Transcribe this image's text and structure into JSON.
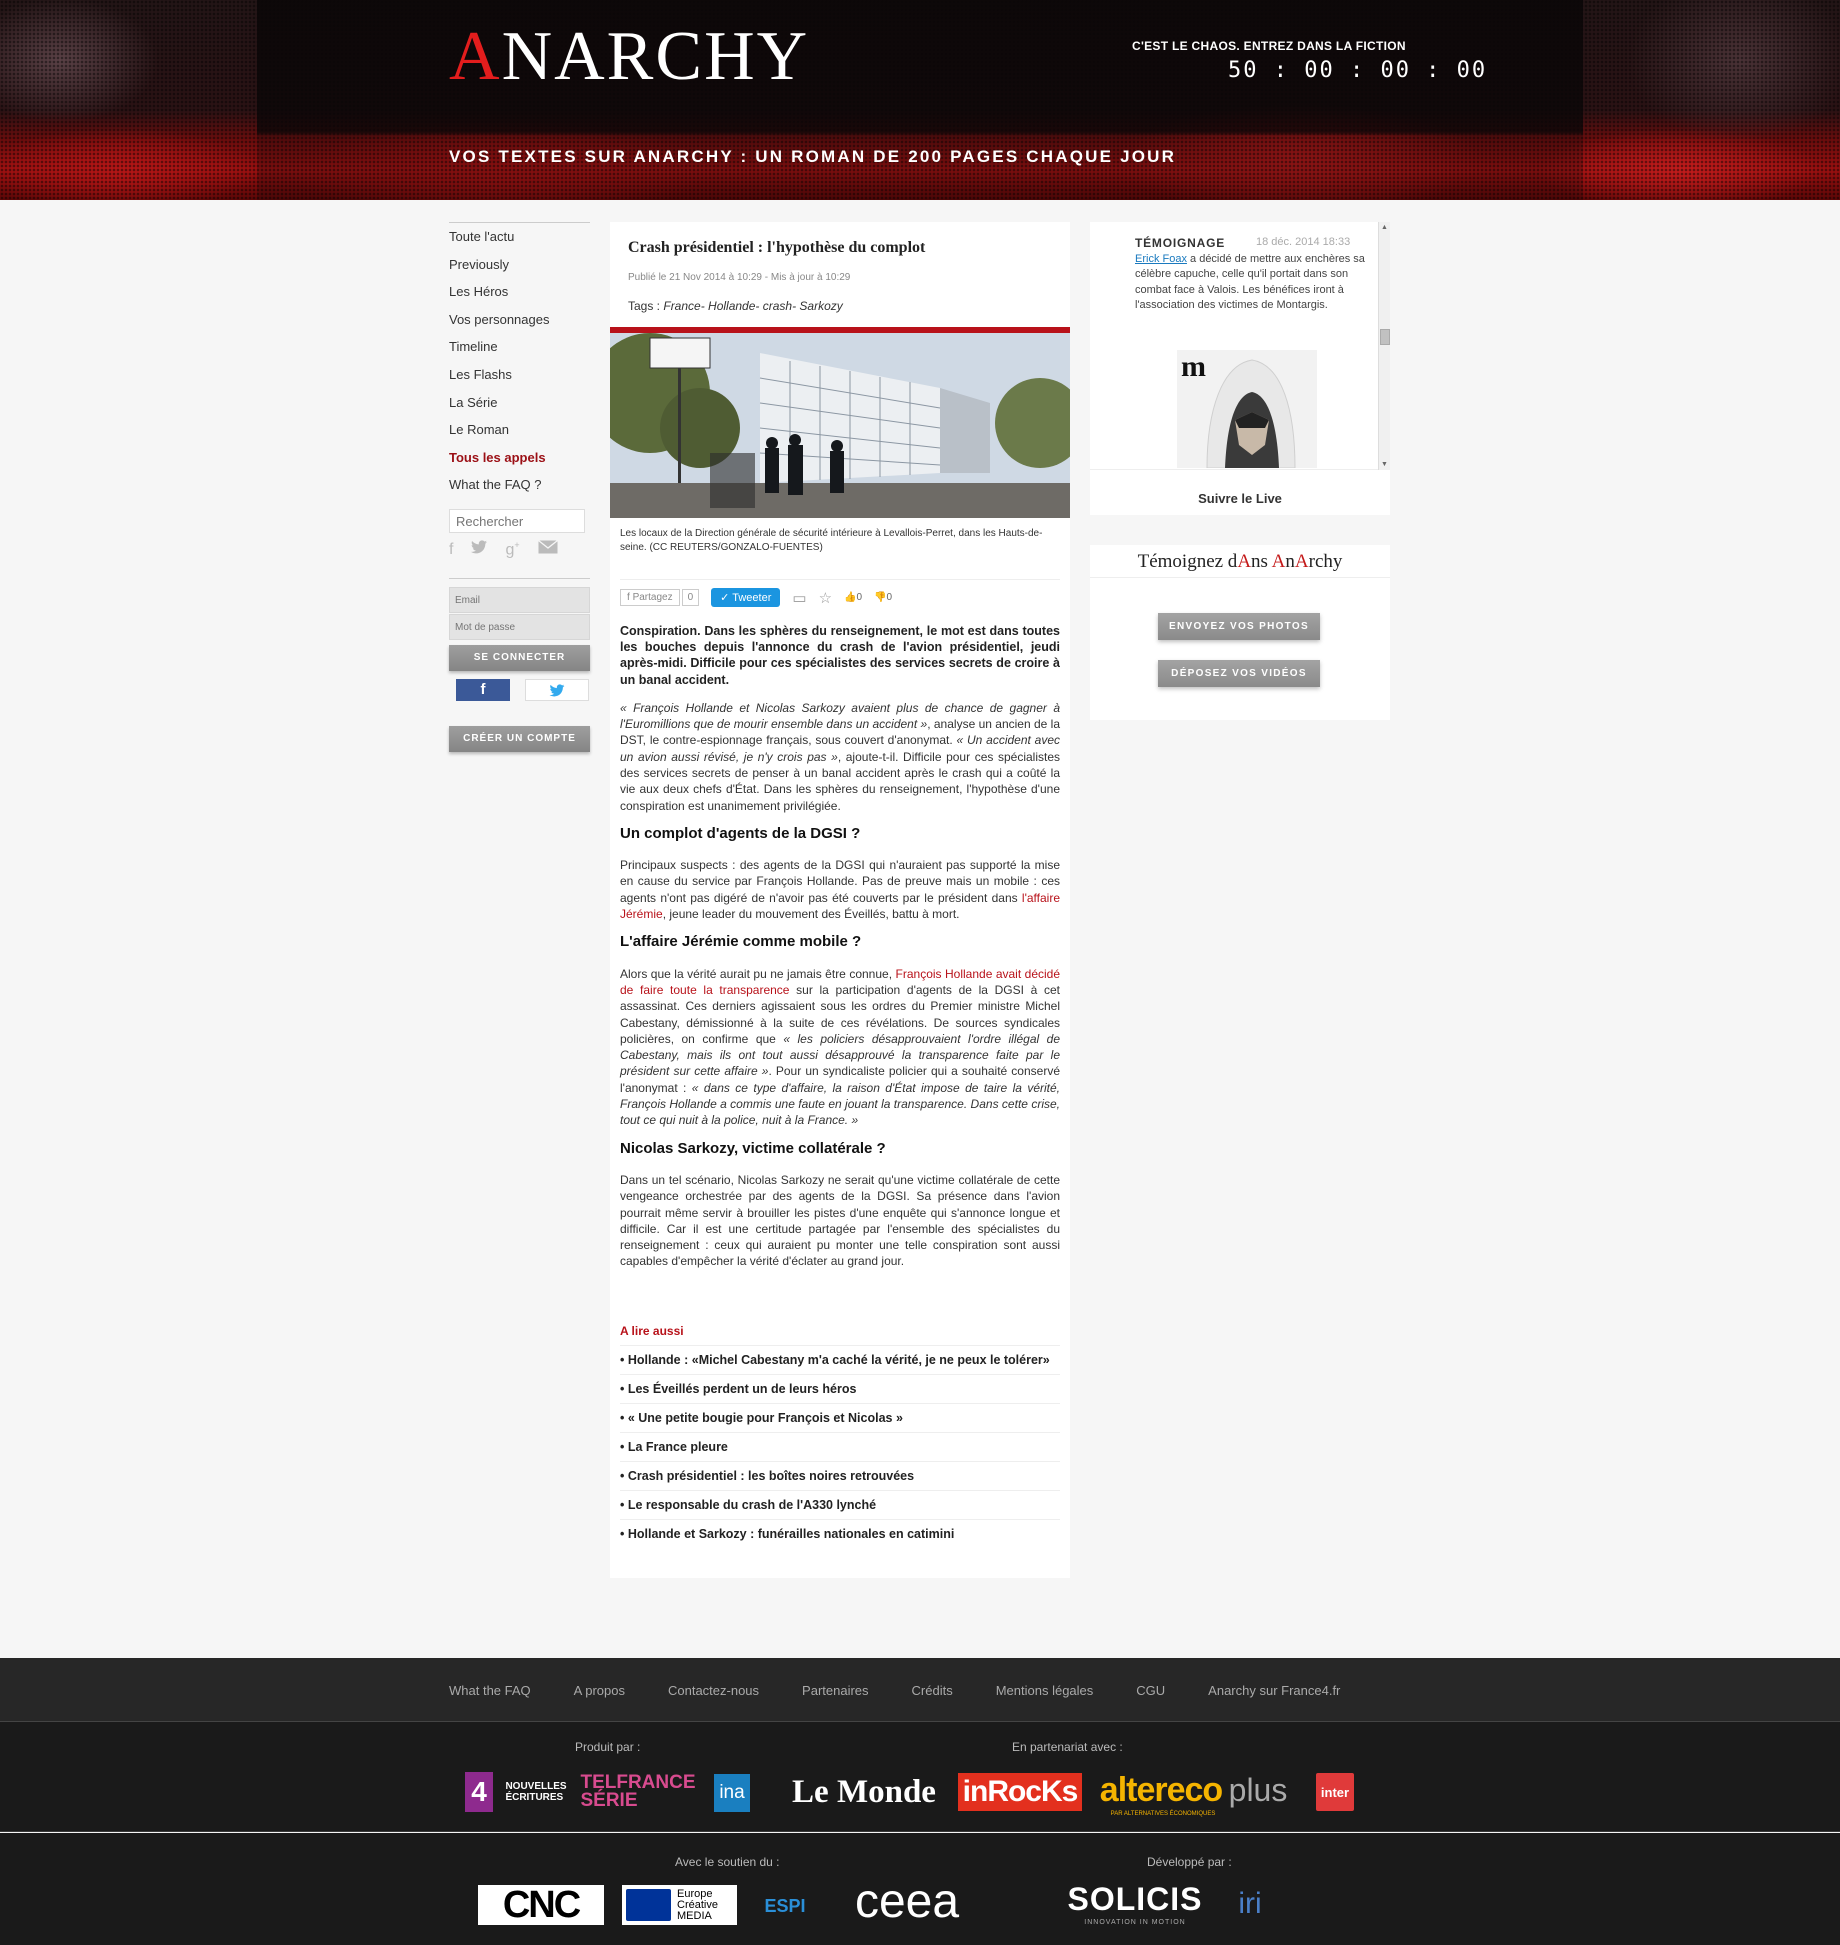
{
  "header": {
    "logo_pre": "A",
    "logo_mid": "NAR",
    "logo_c": "C",
    "logo_post": "HY",
    "tagline": "C'EST LE CHAOS. ENTREZ DANS LA FICTION",
    "countdown": "50 : 00 : 00 : 00",
    "banner": "VOS TEXTES SUR ANARCHY : UN ROMAN DE 200 PAGES CHAQUE JOUR"
  },
  "nav": {
    "items": [
      "Toute l'actu",
      "Previously",
      "Les Héros",
      "Vos personnages",
      "Timeline",
      "Les Flashs",
      "La Série",
      "Le Roman",
      "Tous les appels",
      "What the FAQ ?"
    ],
    "search_placeholder": "Rechercher",
    "email_placeholder": "Email",
    "password_placeholder": "Mot de passe",
    "login_label": "SE CONNECTER",
    "create_label": "CRÉER UN COMPTE"
  },
  "article": {
    "title": "Crash présidentiel : l'hypothèse du complot",
    "meta": "Publié le 21 Nov 2014 à 10:29 - Mis à jour à 10:29",
    "tags_label": "Tags : ",
    "tags": "France- Hollande- crash- Sarkozy",
    "caption": "Les locaux de la Direction générale de sécurité intérieure à Levallois-Perret, dans les Hauts-de-seine.  (CC REUTERS/GONZALO-FUENTES)",
    "share_fb": "Partagez",
    "share_count": "0",
    "share_tw": "Tweeter",
    "like_count": "0",
    "dislike_count": "0",
    "lead": "Conspiration. Dans les sphères du renseignement, le mot est dans toutes les bouches depuis l'annonce du crash de l'avion présidentiel, jeudi après-midi. Difficile pour ces spécialistes des services secrets de croire à un banal accident.",
    "p1_q1": "« François Hollande et Nicolas Sarkozy avaient plus de chance de gagner à l'Euromillions que de mourir ensemble dans un accident »",
    "p1_t1": ", analyse un ancien de la DST, le contre-espionnage français, sous couvert d'anonymat. ",
    "p1_q2": "« Un accident avec un avion aussi révisé, je n'y crois pas »",
    "p1_t2": ", ajoute-t-il. Difficile pour ces spécialistes des services secrets de penser à un banal accident après le crash qui a coûté la vie aux deux chefs d'État. Dans les sphères du renseignement, l'hypothèse d'une conspiration est unanimement privilégiée.",
    "h1": "Un complot d'agents de la DGSI ?",
    "p2_t1": "Principaux suspects : des agents de la DGSI qui n'auraient pas supporté la mise en cause du service par François Hollande. Pas de preuve mais un mobile : ces agents n'ont pas digéré de n'avoir pas été couverts par le président dans ",
    "p2_link": "l'affaire Jérémie",
    "p2_t2": ", jeune leader du mouvement des Éveillés, battu à mort.",
    "h2": "L'affaire Jérémie comme mobile ?",
    "p3_t1": "Alors que la vérité aurait pu ne jamais être connue, ",
    "p3_link": "François Hollande avait décidé de faire toute la transparence",
    "p3_t2": " sur la participation d'agents de la DGSI à cet assassinat. Ces derniers agissaient sous les ordres du Premier ministre Michel Cabestany, démissionné à la suite de ces révélations. De sources syndicales policières, on confirme que ",
    "p3_q1": "« les policiers désapprouvaient l'ordre illégal de Cabestany, mais ils ont tout aussi désapprouvé la transparence faite par le président sur cette affaire »",
    "p3_t3": ". Pour un syndicaliste policier qui a souhaité conservé l'anonymat : ",
    "p3_q2": "« dans ce type d'affaire, la raison d'État impose de taire la vérité, François Hollande a commis une faute en jouant la transparence. Dans cette crise, tout ce qui nuit à la police, nuit à la France. »",
    "h3": "Nicolas Sarkozy, victime collatérale ?",
    "p4": "Dans un tel scénario, Nicolas Sarkozy ne serait qu'une victime collatérale de cette vengeance orchestrée par des agents de la DGSI. Sa présence dans l'avion pourrait même servir à brouiller les pistes d'une enquête qui s'annonce longue et difficile. Car il est une certitude partagée par l'ensemble des spécialistes du renseignement : ceux qui auraient pu monter une telle conspiration sont aussi capables d'empêcher la vérité d'éclater au grand jour.",
    "read_also": "A lire aussi",
    "related": [
      "• Hollande : «Michel Cabestany m'a caché la vérité, je ne peux le tolérer»",
      "• Les Éveillés perdent un de leurs héros",
      "• « Une petite bougie pour François et Nicolas »",
      "• La France pleure",
      "• Crash présidentiel : les boîtes noires retrouvées",
      "• Le responsable du crash de l'A330 lynché",
      "• Hollande et Sarkozy : funérailles nationales en catimini"
    ]
  },
  "live": {
    "kind": "TÉMOIGNAGE",
    "date": "18 déc. 2014 18:33",
    "author": "Erick Foax",
    "text": " a décidé de mettre aux enchères sa célèbre capuche, celle qu'il portait dans son combat face à Valois. Les bénéfices iront à l'association des victimes de Montargis.",
    "follow": "Suivre le Live"
  },
  "temoignez": {
    "t1": "Témoignez d",
    "t2": "A",
    "t3": "ns ",
    "t4": "A",
    "t5": "n",
    "t6": "A",
    "t7": "rchy",
    "photos_btn": "ENVOYEZ VOS PHOTOS",
    "videos_btn": "DÉPOSEZ VOS VIDÉOS"
  },
  "footer": {
    "links": [
      "What the FAQ",
      "A propos",
      "Contactez-nous",
      "Partenaires",
      "Crédits",
      "Mentions légales",
      "CGU",
      "Anarchy sur France4.fr"
    ],
    "produced_by": "Produit par :",
    "partnership": "En partenariat avec :",
    "support": "Avec le soutien du :",
    "developed": "Développé par :",
    "logos": {
      "f4": "4",
      "nouvelles": "NOUVELLES ÉCRITURES",
      "telfrance": "TELFRANCE SÉRIE",
      "ina": "ina",
      "lemonde": "Le Monde",
      "inrocks": "inRocKs",
      "alterneco": "altereco",
      "plus": "plus",
      "alter_sub": "PAR ALTERNATIVES ÉCONOMIQUES",
      "inter": "inter",
      "cnc": "CNC",
      "europe": "Europe Créative MEDIA",
      "espi": "ESPI",
      "ceea": "ceea",
      "solicis": "SOLICIS",
      "solicis_sub": "INNOVATION IN MOTION",
      "iri": "iri"
    }
  },
  "colors": {
    "accent_red": "#b8121a",
    "link_blue": "#1a7abf",
    "footer_bg": "#1a1a1a"
  }
}
